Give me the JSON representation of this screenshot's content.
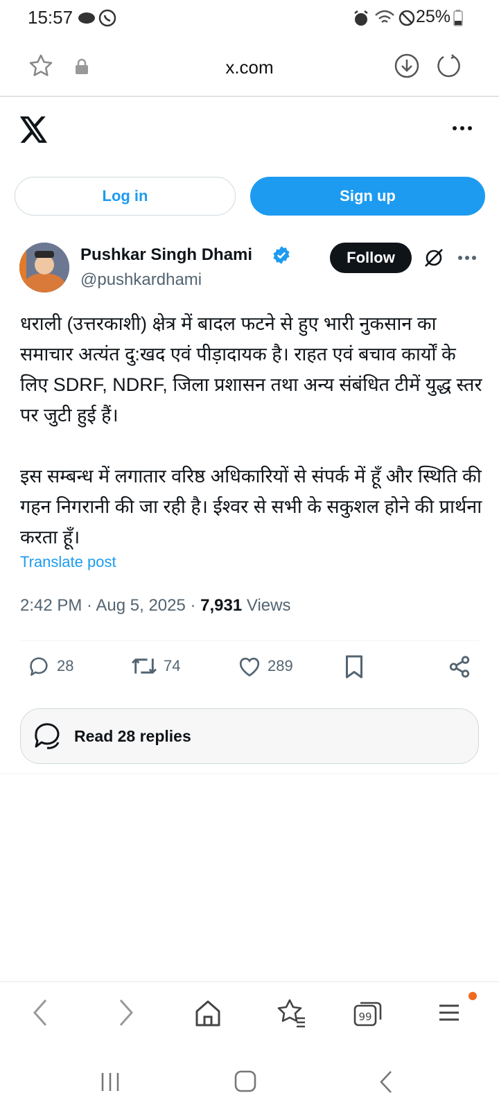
{
  "status_bar": {
    "time": "15:57",
    "battery": "25%"
  },
  "browser": {
    "url": "x.com"
  },
  "auth": {
    "login_label": "Log in",
    "signup_label": "Sign up"
  },
  "tweet": {
    "name": "Pushkar Singh Dhami",
    "handle": "@pushkardhami",
    "follow_label": "Follow",
    "text": "धराली (उत्तरकाशी) क्षेत्र में बादल फटने से हुए भारी नुकसान का समाचार अत्यंत दु:खद एवं पीड़ादायक है। राहत एवं बचाव कार्यों के लिए SDRF, NDRF, जिला प्रशासन तथा अन्य संबंधित टीमें युद्ध स्तर पर जुटी हुई हैं।\n\nइस सम्बन्ध में लगातार वरिष्ठ अधिकारियों से संपर्क में हूँ और स्थिति की गहन निगरानी की जा रही है। ईश्वर से सभी के सकुशल होने की प्रार्थना करता हूँ।",
    "translate_label": "Translate post",
    "timestamp": "2:42 PM · Aug 5, 2025 · ",
    "views_count": "7,931",
    "views_label": " Views",
    "replies": "28",
    "reposts": "74",
    "likes": "289",
    "read_replies_label": "Read 28 replies"
  },
  "colors": {
    "accent": "#1d9bf0",
    "text": "#0f1419",
    "muted": "#536471"
  }
}
